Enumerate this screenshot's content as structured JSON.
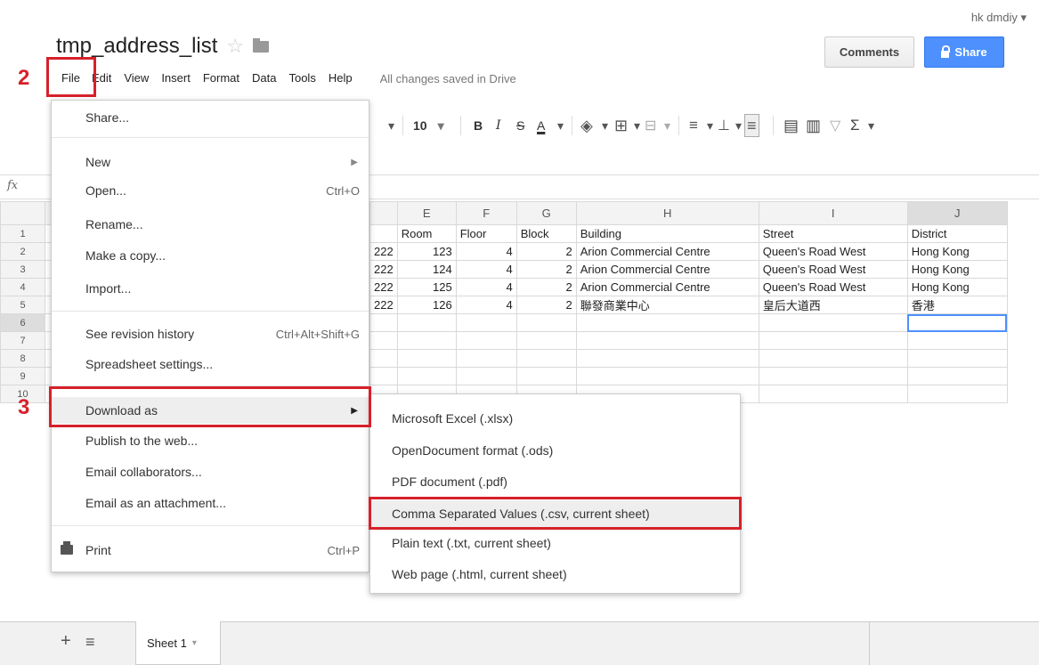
{
  "user": {
    "name": "hk dmdiy",
    "caret": "▾"
  },
  "doc": {
    "title": "tmp_address_list",
    "star": "☆"
  },
  "buttons": {
    "comments": "Comments",
    "share": "Share"
  },
  "menubar": {
    "items": [
      "File",
      "Edit",
      "View",
      "Insert",
      "Format",
      "Data",
      "Tools",
      "Help"
    ],
    "status": "All changes saved in Drive"
  },
  "toolbar": {
    "font_size": "10",
    "bold": "B",
    "italic": "I",
    "strike": "S",
    "text_color": "A",
    "sum": "Σ"
  },
  "formula_bar": {
    "fx": "fx"
  },
  "sheet": {
    "columns": [
      "E",
      "F",
      "G",
      "H",
      "I",
      "J"
    ],
    "row_numbers": [
      "1",
      "2",
      "3",
      "4",
      "5",
      "6",
      "7",
      "8",
      "9",
      "10"
    ],
    "partial_d": [
      "",
      "222",
      "222",
      "222",
      "222",
      "",
      "",
      "",
      "",
      ""
    ],
    "rows": [
      [
        "Room",
        "Floor",
        "Block",
        "Building",
        "Street",
        "District"
      ],
      [
        "123",
        "4",
        "2",
        "Arion Commercial Centre",
        "Queen's Road West",
        "Hong Kong"
      ],
      [
        "124",
        "4",
        "2",
        "Arion Commercial Centre",
        "Queen's Road West",
        "Hong Kong"
      ],
      [
        "125",
        "4",
        "2",
        "Arion Commercial Centre",
        "Queen's Road West",
        "Hong Kong"
      ],
      [
        "126",
        "4",
        "2",
        "聯發商業中心",
        "皇后大道西",
        "香港"
      ]
    ]
  },
  "file_menu": {
    "share": "Share...",
    "new": "New",
    "open": "Open...",
    "open_sc": "Ctrl+O",
    "rename": "Rename...",
    "copy": "Make a copy...",
    "import": "Import...",
    "revision": "See revision history",
    "revision_sc": "Ctrl+Alt+Shift+G",
    "settings": "Spreadsheet settings...",
    "download": "Download as",
    "publish": "Publish to the web...",
    "email_collab": "Email collaborators...",
    "email_attach": "Email as an attachment...",
    "print": "Print",
    "print_sc": "Ctrl+P",
    "arrow": "▶"
  },
  "download_menu": {
    "xlsx": "Microsoft Excel (.xlsx)",
    "ods": "OpenDocument format (.ods)",
    "pdf": "PDF document (.pdf)",
    "csv": "Comma Separated Values (.csv, current sheet)",
    "txt": "Plain text (.txt, current sheet)",
    "html": "Web page (.html, current sheet)"
  },
  "bottom": {
    "add": "+",
    "list": "≡",
    "sheet_tab": "Sheet 1",
    "caret": "▾"
  },
  "annotations": {
    "step2": "2",
    "step3": "3",
    "highlight_color": "#d6212a"
  }
}
